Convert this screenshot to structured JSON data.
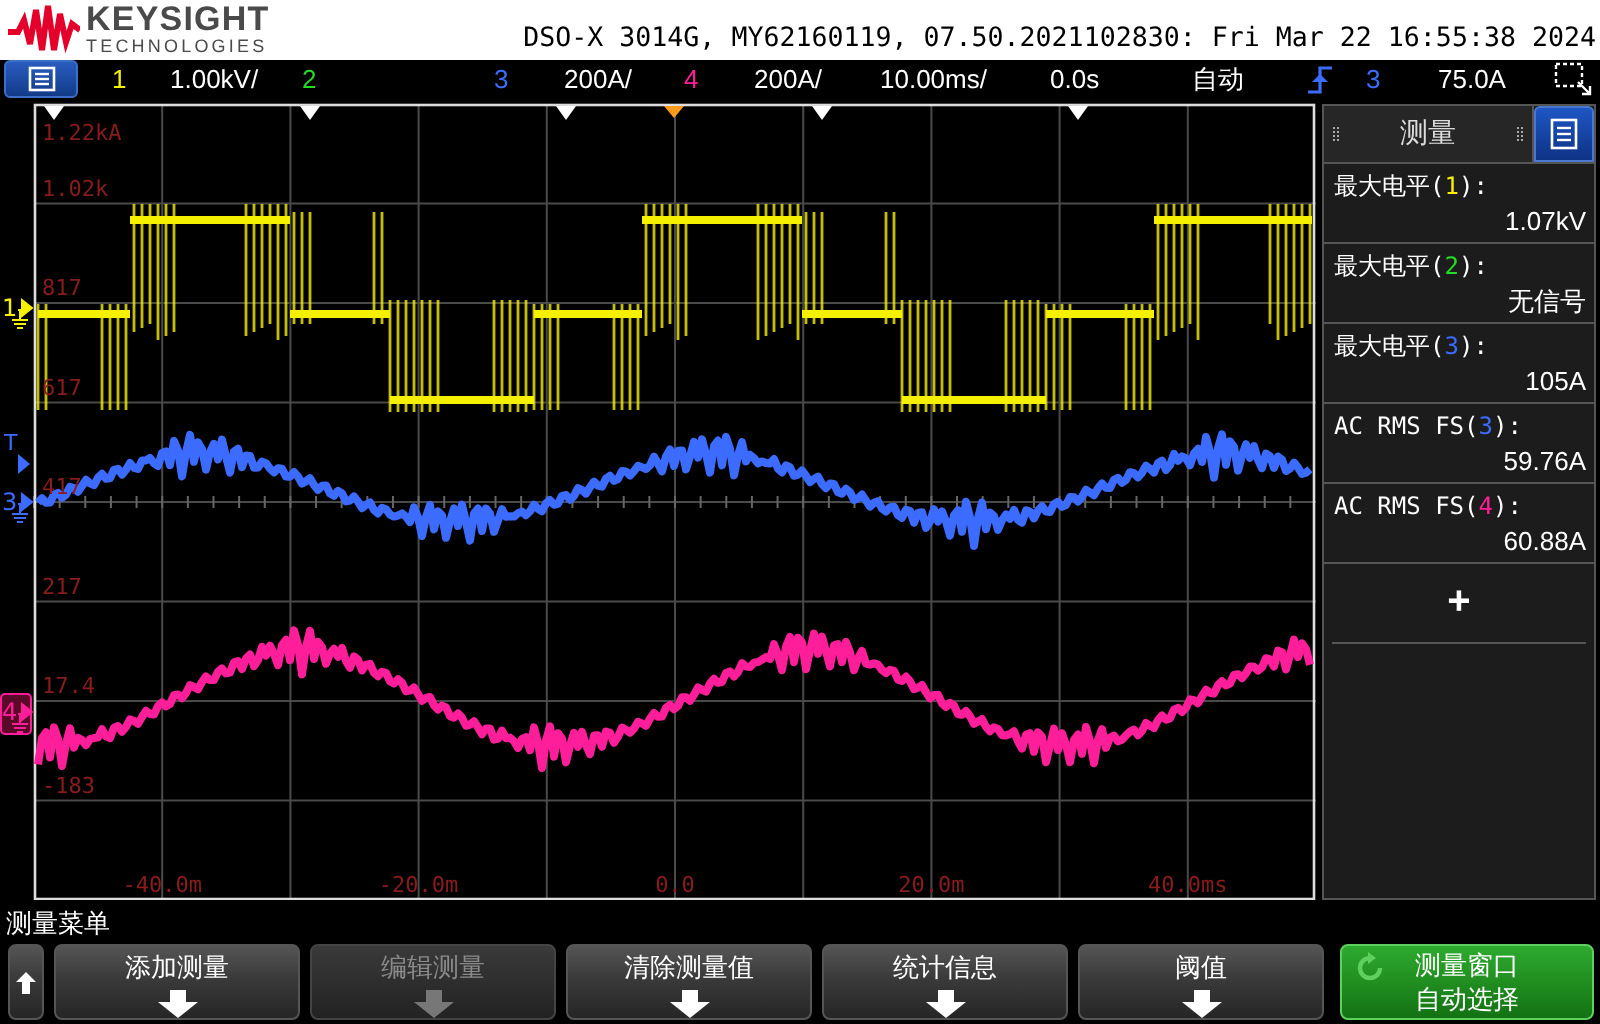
{
  "header": {
    "brand": "KEYSIGHT",
    "brand_sub": "TECHNOLOGIES",
    "title": "DSO-X 3014G, MY62160119, 07.50.2021102830: Fri Mar 22 16:55:38 2024"
  },
  "status_bar": {
    "channels": [
      {
        "number": "1",
        "scale": "1.00kV/",
        "color": "#f5f000"
      },
      {
        "number": "2",
        "color": "#22dd22"
      },
      {
        "number": "3",
        "scale": "200A/",
        "color": "#3b6cff"
      },
      {
        "number": "4",
        "scale": "200A/",
        "color": "#ff1e9a"
      }
    ],
    "timebase": "10.00ms/",
    "delay": "0.0s",
    "trigger_mode": "自动",
    "trigger_source": "3",
    "trigger_level": "75.0A"
  },
  "screen": {
    "y_labels": [
      "1.22kA",
      "1.02k",
      "817",
      "617",
      "417",
      "217",
      "17.4",
      "-183"
    ],
    "x_labels": [
      "-40.0m",
      "-20.0m",
      "0.0",
      "20.0m",
      "40.0ms"
    ],
    "trigger_marker": "T",
    "channel_markers": [
      {
        "label": "1",
        "color": "#f5f000",
        "selected": false
      },
      {
        "label": "3",
        "color": "#3b6cff",
        "selected": false
      },
      {
        "label": "4",
        "color": "#ff1e9a",
        "selected": true
      }
    ]
  },
  "measurements": {
    "tab": "测量",
    "items": [
      {
        "prefix": "最大电平(",
        "channel": "1",
        "suffix": "):",
        "value": "1.07kV",
        "color": "#f5f000"
      },
      {
        "prefix": "最大电平(",
        "channel": "2",
        "suffix": "):",
        "value": "无信号",
        "color": "#22dd22"
      },
      {
        "prefix": "最大电平(",
        "channel": "3",
        "suffix": "):",
        "value": "105A",
        "color": "#3b6cff"
      },
      {
        "prefix": "AC RMS FS(",
        "channel": "3",
        "suffix": "):",
        "value": "59.76A",
        "color": "#3b6cff"
      },
      {
        "prefix": "AC RMS FS(",
        "channel": "4",
        "suffix": "):",
        "value": "60.88A",
        "color": "#ff1e9a"
      }
    ],
    "add": "+"
  },
  "softkeys": {
    "title": "测量菜单",
    "keys": [
      {
        "kind": "menu",
        "label": "添加测量",
        "disabled": false
      },
      {
        "kind": "menu",
        "label": "编辑测量",
        "disabled": true
      },
      {
        "kind": "menu",
        "label": "清除测量值",
        "disabled": false
      },
      {
        "kind": "menu",
        "label": "统计信息",
        "disabled": false
      },
      {
        "kind": "menu",
        "label": "阈值",
        "disabled": false
      },
      {
        "kind": "toggle",
        "label": "测量窗口",
        "value": "自动选择"
      }
    ]
  }
}
